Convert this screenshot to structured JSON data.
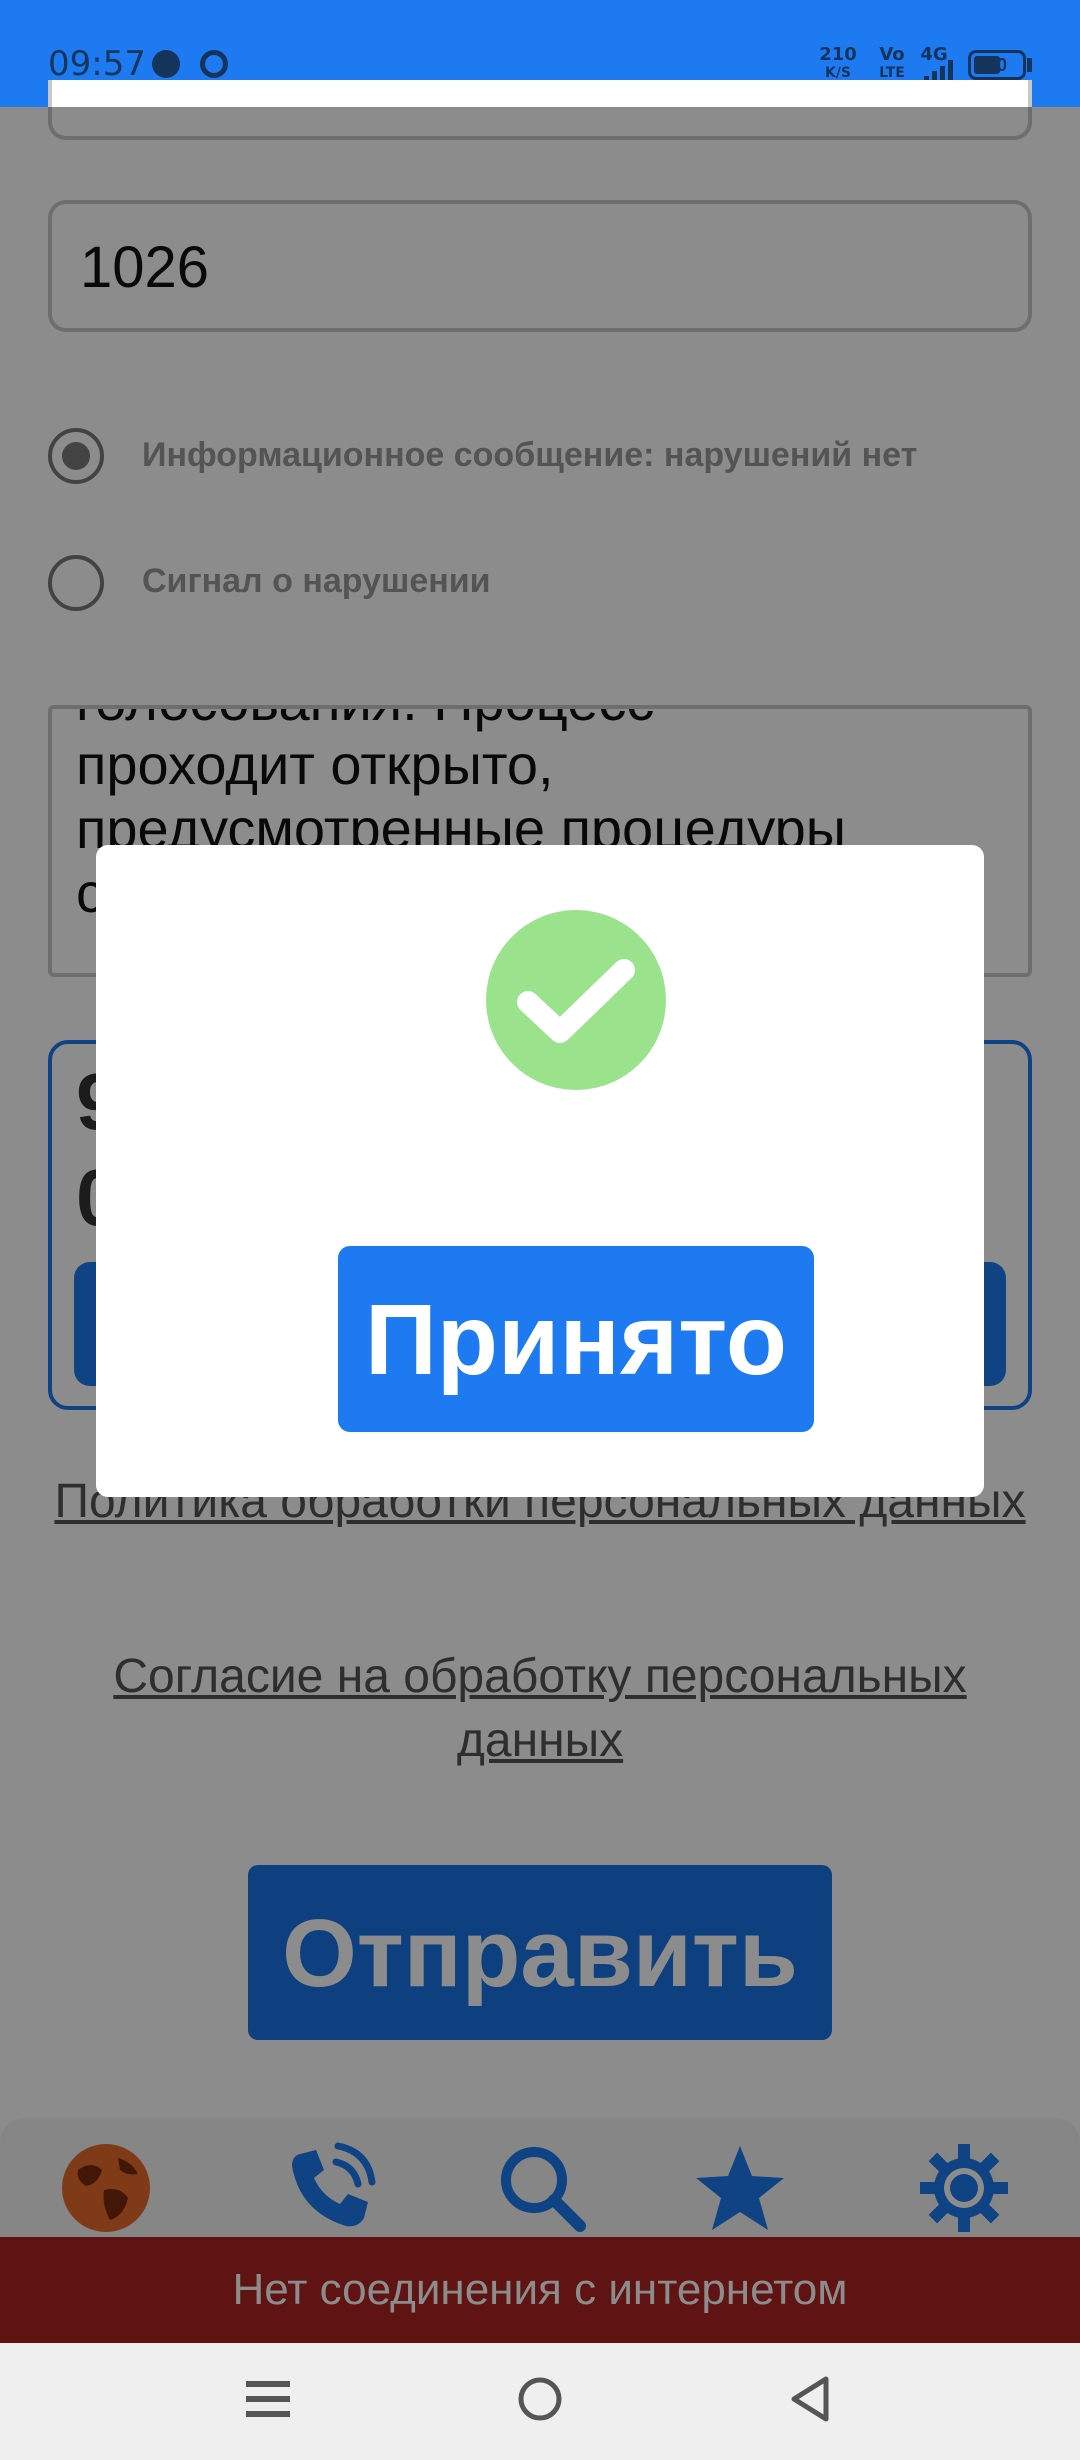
{
  "status_bar": {
    "time": "09:57",
    "net_speed": "210",
    "net_speed_unit": "K/S",
    "volte_top": "Vo",
    "volte_bottom": "LTE",
    "network": "4G",
    "battery": "50"
  },
  "form": {
    "number_value": "1026",
    "radio_info_label": "Информационное сообщение: нарушений нет",
    "radio_violation_label": "Сигнал о нарушении",
    "radio_selected": "info",
    "message_text_lines": [
      "голосования. Процесс",
      "проходит открыто,",
      "предусмотренные процедуры",
      "с"
    ],
    "code_input_partial": [
      "9",
      "0"
    ]
  },
  "links": {
    "privacy_policy": "Политика обработки персональных данных",
    "consent": "Согласие на обработку персональных данных"
  },
  "send_button_label": "Отправить",
  "bottom_nav": {
    "items": [
      "globe-icon",
      "phone-icon",
      "search-icon",
      "star-icon",
      "gear-icon"
    ]
  },
  "offline_message": "Нет соединения с интернетом",
  "dialog": {
    "icon": "check-circle-icon",
    "ok_label": "Принято"
  },
  "colors": {
    "primary": "#1d7af0",
    "success": "#9be28c",
    "offline": "#b02323"
  }
}
